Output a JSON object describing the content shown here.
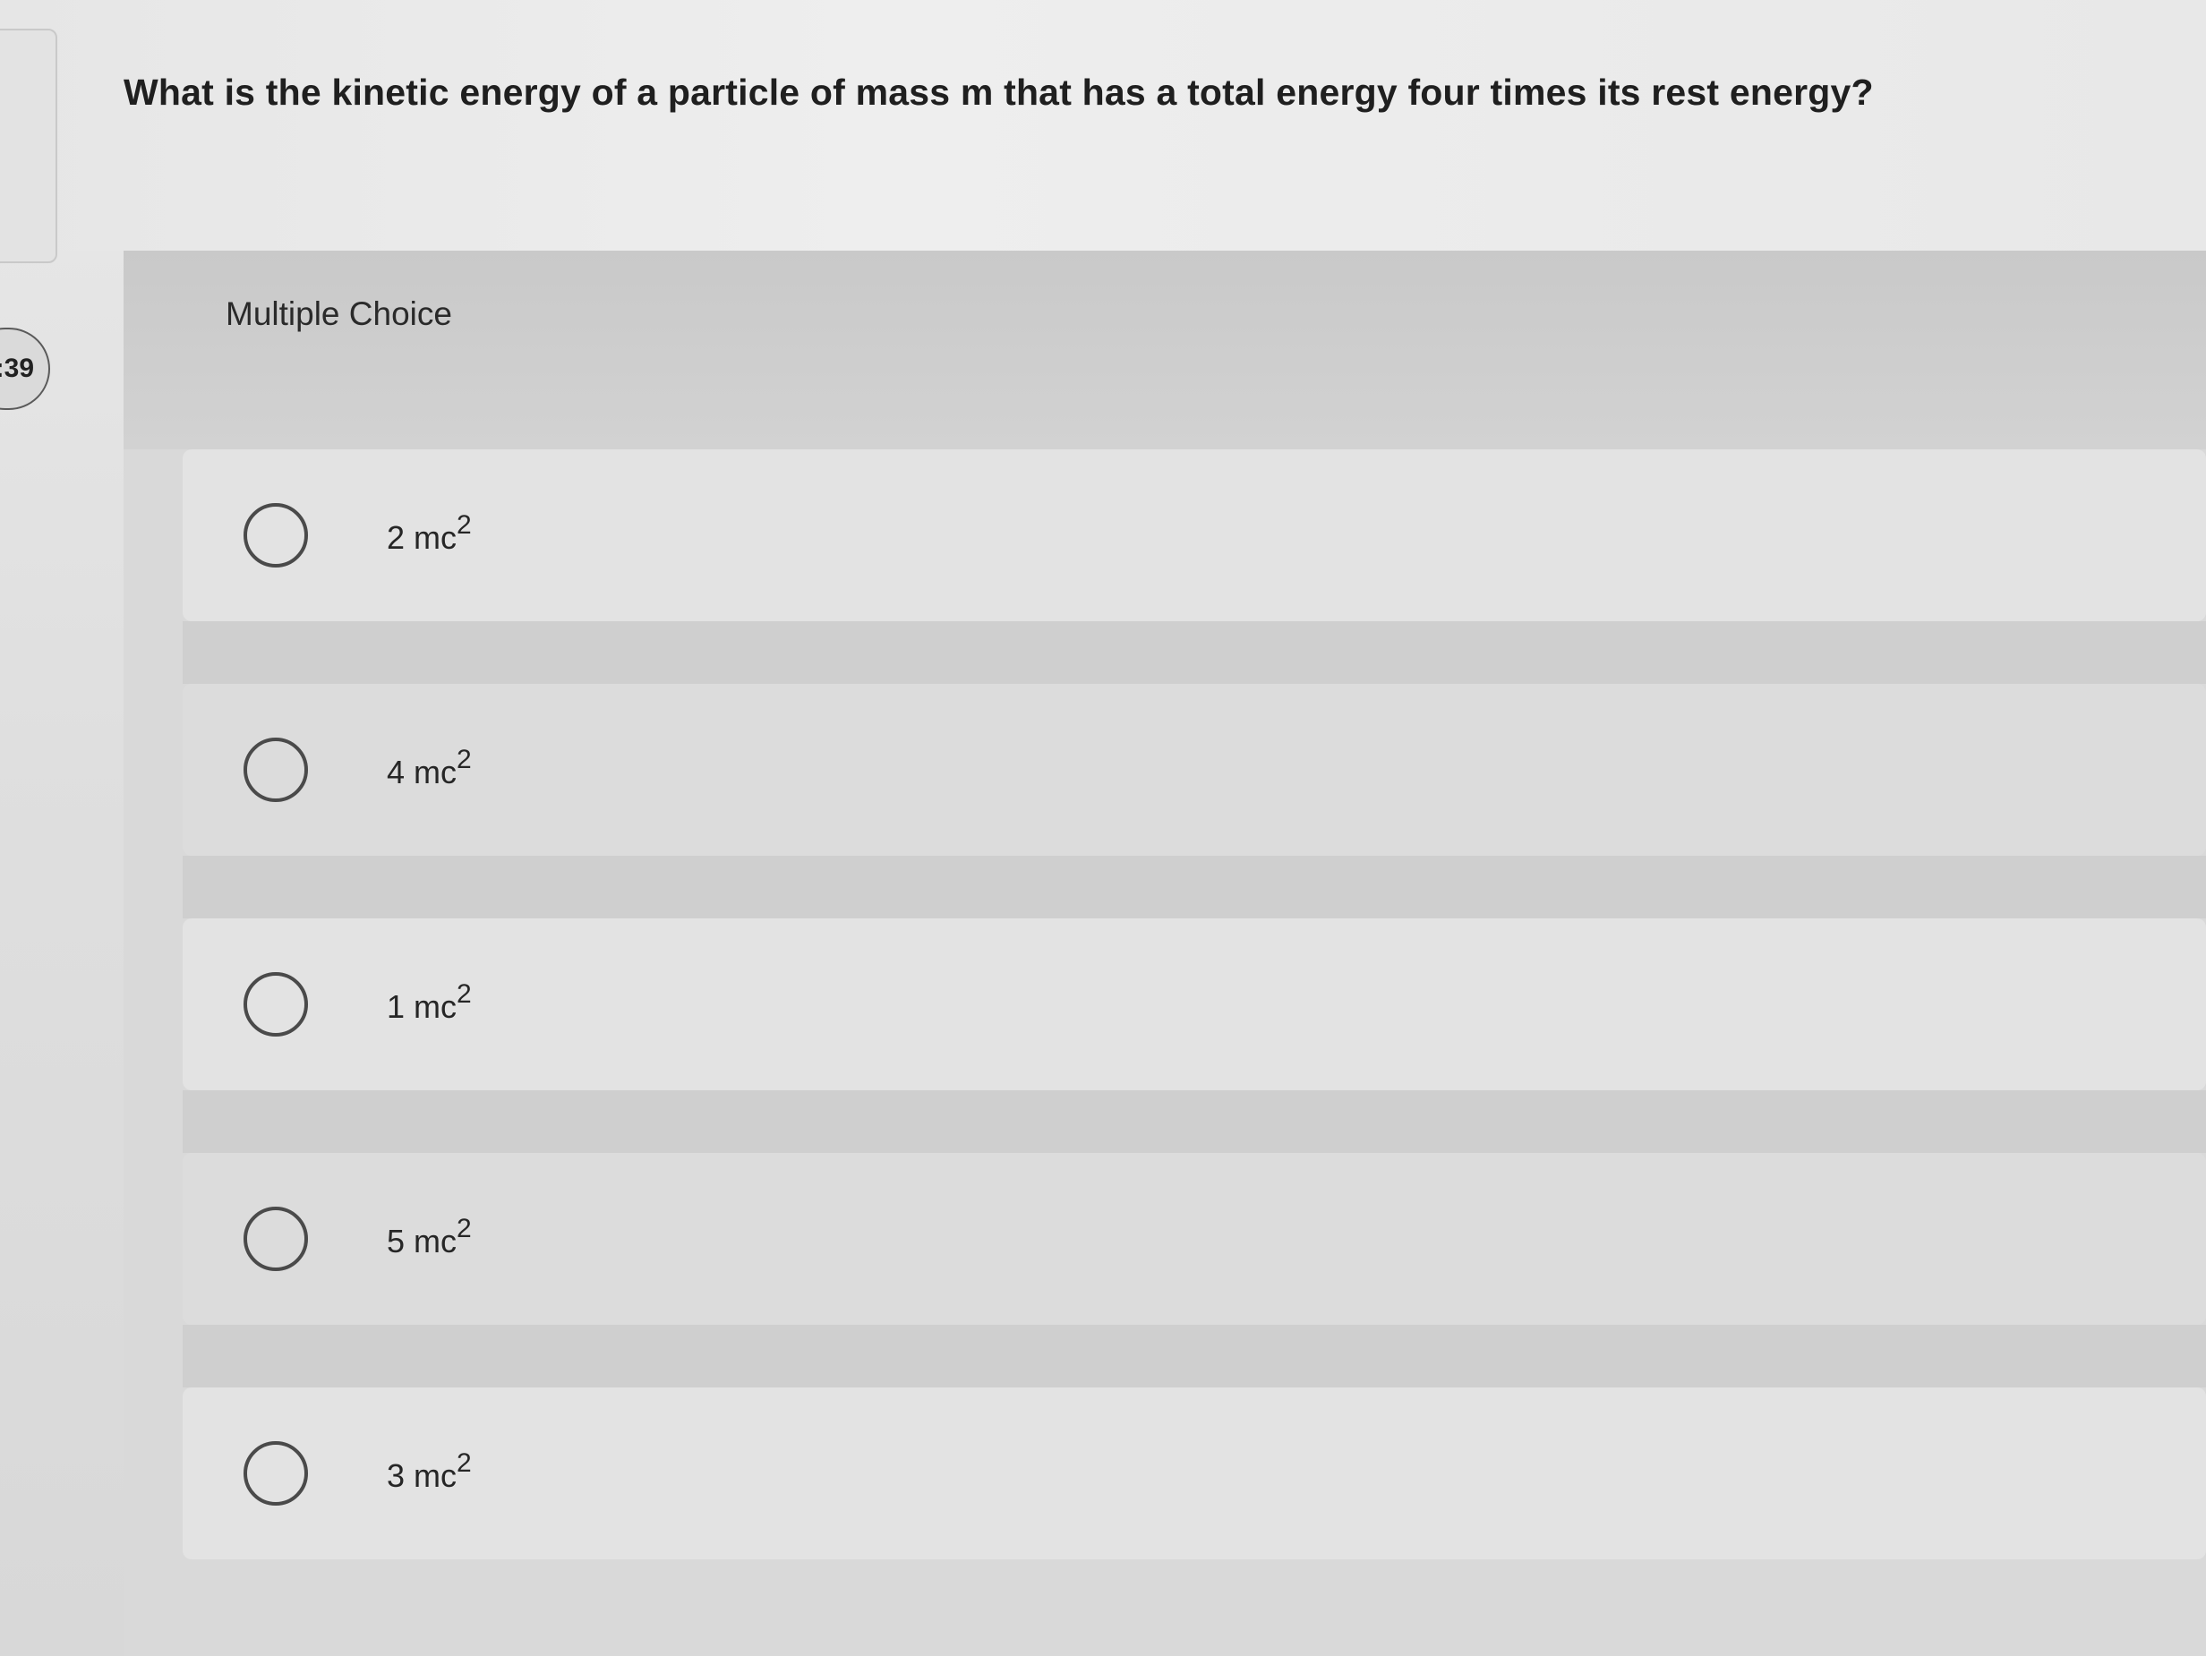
{
  "question": {
    "text": "What is the kinetic energy of a particle of mass m that has a total energy four times its rest energy?"
  },
  "timer": {
    "text": ":39"
  },
  "section": {
    "label": "Multiple Choice"
  },
  "options": [
    {
      "value": "2 mc",
      "exponent": "2"
    },
    {
      "value": "4 mc",
      "exponent": "2"
    },
    {
      "value": "1 mc",
      "exponent": "2"
    },
    {
      "value": "5 mc",
      "exponent": "2"
    },
    {
      "value": "3 mc",
      "exponent": "2"
    }
  ]
}
